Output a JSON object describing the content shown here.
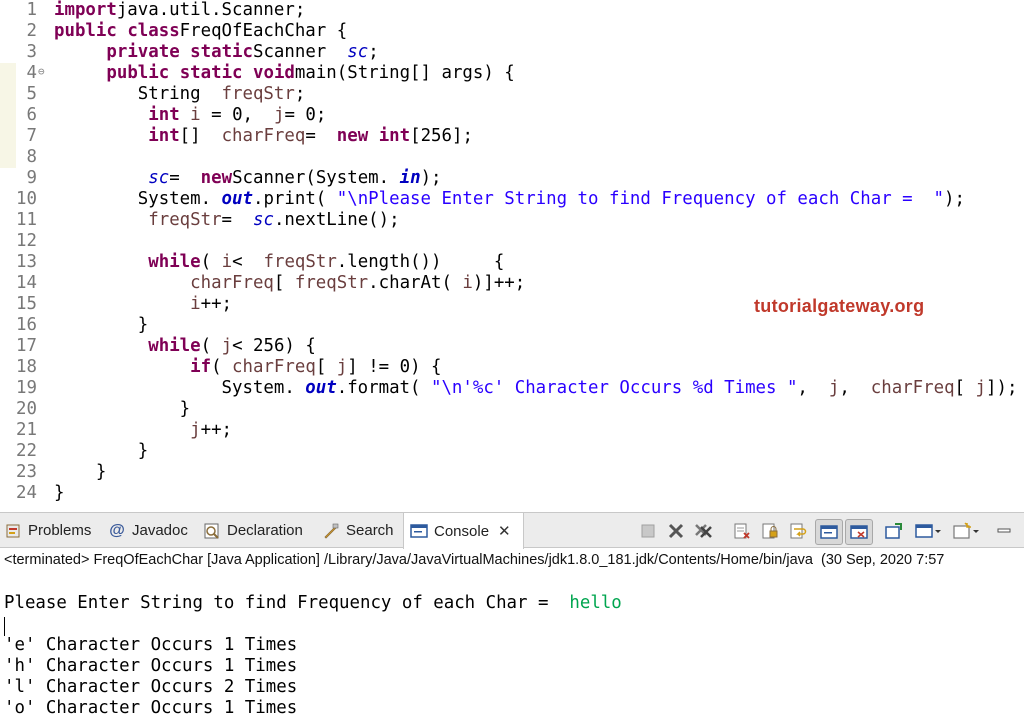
{
  "editor": {
    "lines": [
      {
        "n": "1",
        "parts": [
          [
            "kw",
            "import"
          ],
          [
            "",
            "java.util.Scanner;"
          ]
        ]
      },
      {
        "n": "2",
        "parts": [
          [
            "kw",
            "public"
          ],
          [
            "",
            ""
          ],
          [
            "kw",
            "class"
          ],
          [
            "",
            "FreqOfEachChar {"
          ]
        ]
      },
      {
        "n": "3",
        "parts": [
          [
            "",
            "    "
          ],
          [
            "kw",
            "private"
          ],
          [
            "",
            ""
          ],
          [
            "kw",
            "static"
          ],
          [
            "",
            "Scanner "
          ],
          [
            "fld",
            "sc"
          ],
          [
            "",
            ";"
          ]
        ]
      },
      {
        "n": "4",
        "parts": [
          [
            "",
            "    "
          ],
          [
            "kw",
            "public"
          ],
          [
            "",
            ""
          ],
          [
            "kw",
            "static"
          ],
          [
            "",
            ""
          ],
          [
            "kw",
            "void"
          ],
          [
            "",
            "main(String[] args) {"
          ]
        ]
      },
      {
        "n": "5",
        "parts": [
          [
            "",
            "        String "
          ],
          [
            "var",
            "freqStr"
          ],
          [
            "",
            ";"
          ]
        ]
      },
      {
        "n": "6",
        "parts": [
          [
            "",
            "        "
          ],
          [
            "kw",
            "int"
          ],
          [
            "",
            ""
          ],
          [
            "var",
            "i"
          ],
          [
            "",
            ""
          ],
          [
            "",
            "= 0, "
          ],
          [
            "var",
            "j"
          ],
          [
            "",
            "= 0;"
          ]
        ]
      },
      {
        "n": "7",
        "parts": [
          [
            "",
            "        "
          ],
          [
            "kw",
            "int"
          ],
          [
            "",
            "[] "
          ],
          [
            "var",
            "charFreq"
          ],
          [
            "",
            "= "
          ],
          [
            "kw",
            "new"
          ],
          [
            "",
            ""
          ],
          [
            "kw",
            "int"
          ],
          [
            "",
            "[256];"
          ]
        ]
      },
      {
        "n": "8",
        "parts": []
      },
      {
        "n": "9",
        "parts": [
          [
            "",
            "        "
          ],
          [
            "fld",
            "sc"
          ],
          [
            "",
            "= "
          ],
          [
            "kw",
            "new"
          ],
          [
            "",
            "Scanner(System."
          ],
          [
            "sfld",
            "in"
          ],
          [
            "",
            ");"
          ]
        ]
      },
      {
        "n": "10",
        "parts": [
          [
            "",
            "        System."
          ],
          [
            "sfld",
            "out"
          ],
          [
            "",
            ".print("
          ],
          [
            "str",
            "\"\\nPlease Enter String to find Frequency of each Char =  \""
          ],
          [
            "",
            ");"
          ]
        ]
      },
      {
        "n": "11",
        "parts": [
          [
            "",
            "        "
          ],
          [
            "var",
            "freqStr"
          ],
          [
            "",
            "= "
          ],
          [
            "fld",
            "sc"
          ],
          [
            "",
            ".nextLine();"
          ]
        ]
      },
      {
        "n": "12",
        "parts": []
      },
      {
        "n": "13",
        "parts": [
          [
            "",
            "        "
          ],
          [
            "kw",
            "while"
          ],
          [
            "",
            "("
          ],
          [
            "var",
            "i"
          ],
          [
            "",
            "< "
          ],
          [
            "var",
            "freqStr"
          ],
          [
            "",
            ".length())     {"
          ]
        ]
      },
      {
        "n": "14",
        "parts": [
          [
            "",
            "            "
          ],
          [
            "var",
            "charFreq"
          ],
          [
            "",
            "["
          ],
          [
            "var",
            "freqStr"
          ],
          [
            "",
            ".charAt("
          ],
          [
            "var",
            "i"
          ],
          [
            "",
            ")]++;"
          ]
        ]
      },
      {
        "n": "15",
        "parts": [
          [
            "",
            "            "
          ],
          [
            "var",
            "i"
          ],
          [
            "",
            "++;"
          ]
        ]
      },
      {
        "n": "16",
        "parts": [
          [
            "",
            "        }"
          ]
        ]
      },
      {
        "n": "17",
        "parts": [
          [
            "",
            "        "
          ],
          [
            "kw",
            "while"
          ],
          [
            "",
            "("
          ],
          [
            "var",
            "j"
          ],
          [
            "",
            "< 256) {"
          ]
        ]
      },
      {
        "n": "18",
        "parts": [
          [
            "",
            "            "
          ],
          [
            "kw",
            "if"
          ],
          [
            "",
            "("
          ],
          [
            "var",
            "charFreq"
          ],
          [
            "",
            "["
          ],
          [
            "var",
            "j"
          ],
          [
            "",
            "] != 0) {"
          ]
        ]
      },
      {
        "n": "19",
        "parts": [
          [
            "",
            "                System."
          ],
          [
            "sfld",
            "out"
          ],
          [
            "",
            ".format("
          ],
          [
            "str",
            "\"\\n'%c' Character Occurs %d Times \""
          ],
          [
            "",
            ", "
          ],
          [
            "var",
            "j"
          ],
          [
            "",
            ", "
          ],
          [
            "var",
            "charFreq"
          ],
          [
            "",
            "["
          ],
          [
            "var",
            "j"
          ],
          [
            "",
            "]);"
          ]
        ]
      },
      {
        "n": "20",
        "parts": [
          [
            "",
            "            }"
          ]
        ]
      },
      {
        "n": "21",
        "parts": [
          [
            "",
            "            "
          ],
          [
            "var",
            "j"
          ],
          [
            "",
            "++;"
          ]
        ]
      },
      {
        "n": "22",
        "parts": [
          [
            "",
            "        }"
          ]
        ]
      },
      {
        "n": "23",
        "parts": [
          [
            "",
            "    }"
          ]
        ]
      },
      {
        "n": "24",
        "parts": [
          [
            "",
            "}"
          ]
        ]
      }
    ],
    "fold_marker": "⊖",
    "watermark": "tutorialgateway.org"
  },
  "tabs": [
    {
      "label": "Problems",
      "icon": "problems-icon"
    },
    {
      "label": "Javadoc",
      "icon": "javadoc-icon"
    },
    {
      "label": "Declaration",
      "icon": "declaration-icon"
    },
    {
      "label": "Search",
      "icon": "search-icon"
    },
    {
      "label": "Console",
      "icon": "console-icon"
    }
  ],
  "status_line": "<terminated> FreqOfEachChar [Java Application] /Library/Java/JavaVirtualMachines/jdk1.8.0_181.jdk/Contents/Home/bin/java  (30 Sep, 2020 7:57",
  "console": {
    "prompt": "Please Enter String to find Frequency of each Char =  ",
    "input": "hello",
    "results": [
      "'e' Character Occurs 1 Times",
      "'h' Character Occurs 1 Times",
      "'l' Character Occurs 2 Times",
      "'o' Character Occurs 1 Times"
    ]
  }
}
